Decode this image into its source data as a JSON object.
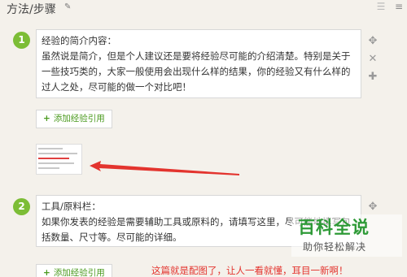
{
  "header": {
    "title": "方法/步骤",
    "edit_icon": "pencil-icon",
    "view_icons": [
      "list-view-icon",
      "detail-view-icon"
    ]
  },
  "steps": [
    {
      "number": "1",
      "heading": "经验的简介内容：",
      "body": "虽然说是简介，但是个人建议还是要将经验尽可能的介绍清楚。特别是关于一些技巧类的，大家一般使用会出现什么样的结果，你的经验又有什么样的过人之处，尽可能的做一个对比吧！",
      "add_ref_label": "添加经验引用",
      "tools": [
        "move-icon",
        "close-icon",
        "add-icon"
      ]
    },
    {
      "number": "2",
      "heading": "工具/原料栏：",
      "body": "如果你发表的经验是需要辅助工具或原料的，请填写这里，尽可能地填写包括数量、尺寸等。尽可能的详细。",
      "add_ref_label": "添加经验引用",
      "tools": [
        "move-icon"
      ]
    }
  ],
  "annotation": {
    "caption": "这篇就是配图了，让人一看就懂，耳目一新啊！",
    "color": "#e3342e"
  },
  "watermark": {
    "title": "百科全说",
    "subtitle": "助你轻松解决"
  },
  "colors": {
    "accent_green": "#7cbd36",
    "link_green": "#4a9a1e",
    "background": "#f4f1eb"
  }
}
